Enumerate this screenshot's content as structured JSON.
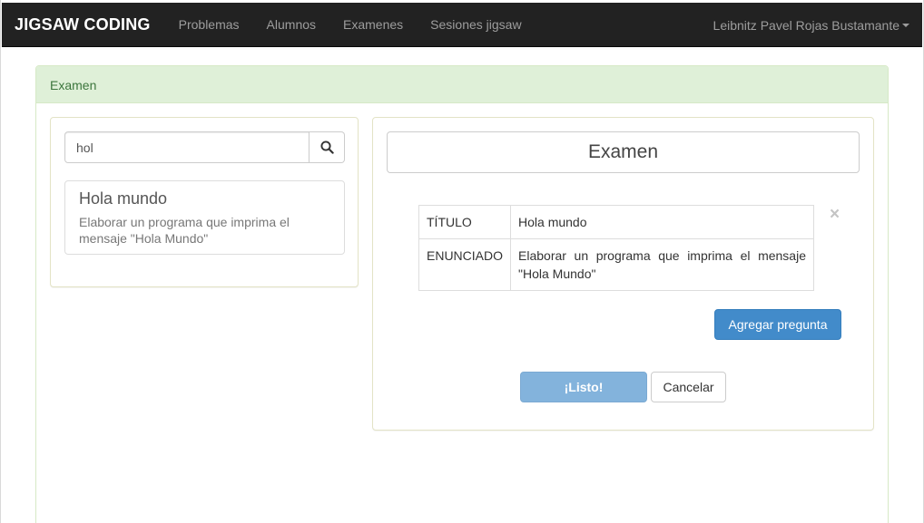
{
  "navbar": {
    "brand": "JIGSAW CODING",
    "links": [
      "Problemas",
      "Alumnos",
      "Examenes",
      "Sesiones jigsaw"
    ],
    "user_name": "Leibnitz Pavel Rojas Bustamante"
  },
  "panel": {
    "heading": "Examen"
  },
  "search": {
    "value": "hol",
    "icon": "search-icon"
  },
  "results": [
    {
      "title": "Hola mundo",
      "description": "Elaborar un programa que imprima el mensaje \"Hola Mundo\""
    }
  ],
  "exam": {
    "title": "Examen",
    "question": {
      "title_label": "TÍTULO",
      "title_value": "Hola mundo",
      "statement_label": "ENUNCIADO",
      "statement_value": "Elaborar un programa que imprima el mensaje \"Hola Mundo\"",
      "remove_glyph": "×"
    },
    "add_question_label": "Agregar pregunta",
    "ready_label": "¡Listo!",
    "cancel_label": "Cancelar"
  },
  "colors": {
    "navbar_bg": "#222222",
    "panel_heading_bg": "#dff0d8",
    "primary": "#428bca"
  }
}
